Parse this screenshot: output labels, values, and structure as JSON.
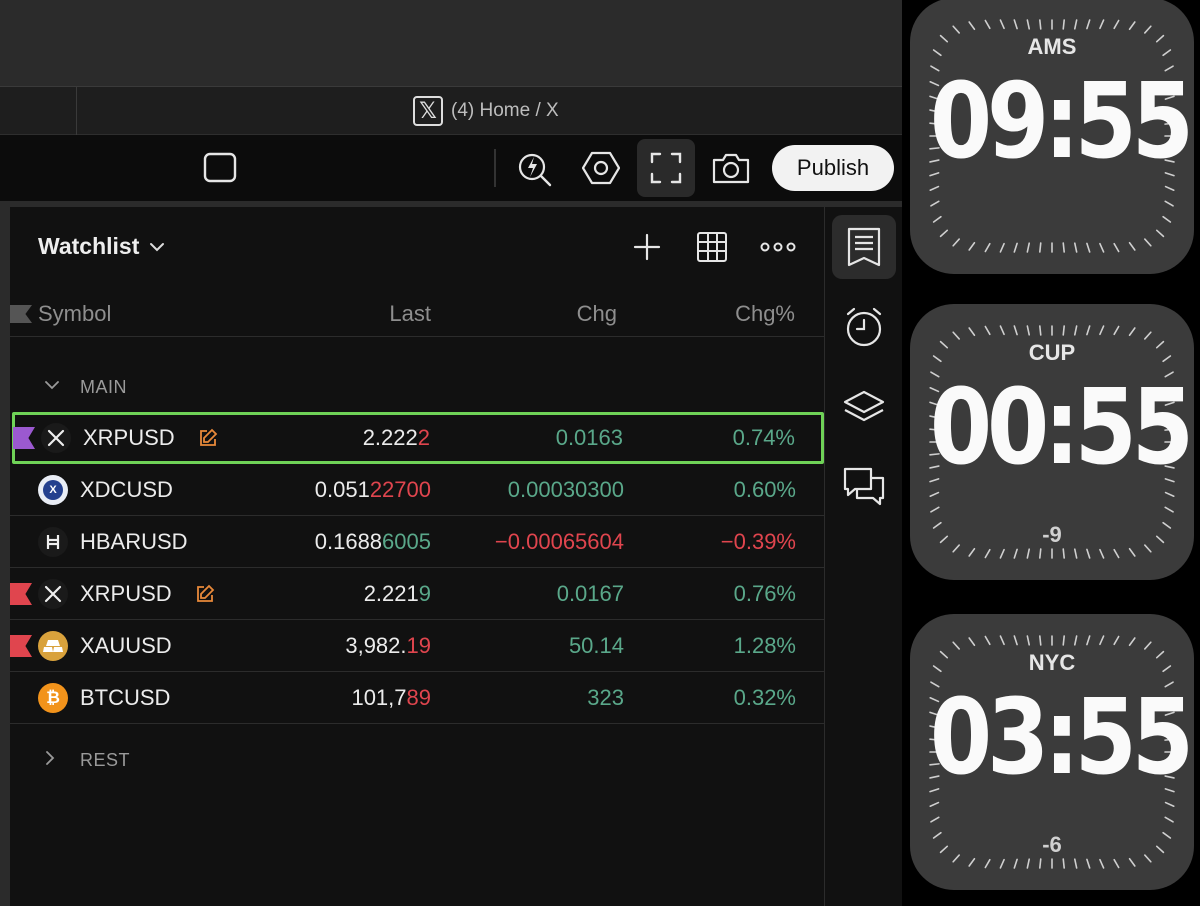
{
  "browser": {
    "tab_title": "(4) Home / X",
    "tab_icon": "x-logo-icon"
  },
  "toolbar": {
    "publish_label": "Publish",
    "icons": [
      "square-icon",
      "replay-icon",
      "settings-hexagon-icon",
      "fullscreen-icon",
      "camera-icon"
    ]
  },
  "watchlist": {
    "title": "Watchlist",
    "columns": {
      "symbol": "Symbol",
      "last": "Last",
      "chg": "Chg",
      "chg_pct": "Chg%"
    },
    "groups": {
      "main": "MAIN",
      "rest": "REST"
    },
    "rows": [
      {
        "flag_color": "#9b59d0",
        "icon": "x-icon",
        "symbol": "XRPUSD",
        "edit": true,
        "last_prefix": "2.222",
        "last_suffix": "2",
        "suffix_color": "red",
        "chg": "0.0163",
        "chg_pct": "0.74%",
        "direction": "up",
        "highlighted": true
      },
      {
        "flag_color": "",
        "icon": "xdc-icon",
        "symbol": "XDCUSD",
        "edit": false,
        "last_prefix": "0.051",
        "last_suffix": "22700",
        "suffix_color": "red",
        "chg": "0.00030300",
        "chg_pct": "0.60%",
        "direction": "up",
        "highlighted": false
      },
      {
        "flag_color": "",
        "icon": "hbar-icon",
        "symbol": "HBARUSD",
        "edit": false,
        "last_prefix": "0.1688",
        "last_suffix": "6005",
        "suffix_color": "green",
        "chg": "−0.00065604",
        "chg_pct": "−0.39%",
        "direction": "down",
        "highlighted": false
      },
      {
        "flag_color": "#e0454e",
        "icon": "x-icon",
        "symbol": "XRPUSD",
        "edit": true,
        "last_prefix": "2.221",
        "last_suffix": "9",
        "suffix_color": "green",
        "chg": "0.0167",
        "chg_pct": "0.76%",
        "direction": "up",
        "highlighted": false
      },
      {
        "flag_color": "#e0454e",
        "icon": "gold-icon",
        "symbol": "XAUUSD",
        "edit": false,
        "last_prefix": "3,982.",
        "last_suffix": "19",
        "suffix_color": "red",
        "chg": "50.14",
        "chg_pct": "1.28%",
        "direction": "up",
        "highlighted": false
      },
      {
        "flag_color": "",
        "icon": "bitcoin-icon",
        "symbol": "BTCUSD",
        "edit": false,
        "last_prefix": "101,7",
        "last_suffix": "89",
        "suffix_color": "red",
        "chg": "323",
        "chg_pct": "0.32%",
        "direction": "up",
        "highlighted": false
      }
    ]
  },
  "sidebar": {
    "icons": [
      "watchlist-icon",
      "alarm-clock-icon",
      "layers-icon",
      "chat-icon"
    ]
  },
  "clocks": [
    {
      "city": "AMS",
      "time": "09:55",
      "offset": ""
    },
    {
      "city": "CUP",
      "time": "00:55",
      "offset": "-9"
    },
    {
      "city": "NYC",
      "time": "03:55",
      "offset": "-6"
    }
  ],
  "colors": {
    "positive": "#5aa88a",
    "negative": "#e0454e",
    "highlight_border": "#6fd257",
    "edit_icon": "#e8893a"
  }
}
